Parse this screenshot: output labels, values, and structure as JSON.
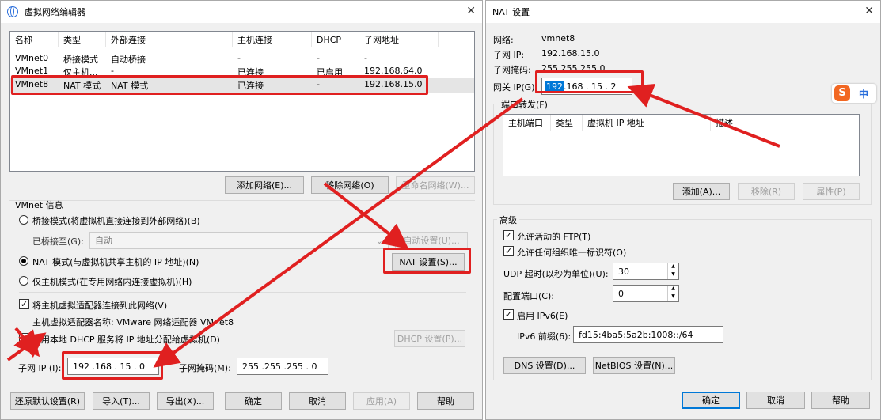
{
  "vne": {
    "title": "虚拟网络编辑器",
    "columns": [
      "名称",
      "类型",
      "外部连接",
      "主机连接",
      "DHCP",
      "子网地址"
    ],
    "rows": [
      [
        "VMnet0",
        "桥接模式",
        "自动桥接",
        "-",
        "-",
        "-"
      ],
      [
        "VMnet1",
        "仅主机...",
        "-",
        "已连接",
        "已启用",
        "192.168.64.0"
      ],
      [
        "VMnet8",
        "NAT 模式",
        "NAT 模式",
        "已连接",
        "-",
        "192.168.15.0"
      ]
    ],
    "add_network": "添加网络(E)...",
    "remove_network": "移除网络(O)",
    "rename_network": "重命名网络(W)...",
    "vmnet_info": "VMnet 信息",
    "bridge_mode": "桥接模式(将虚拟机直接连接到外部网络)(B)",
    "bridged_to_label": "已桥接至(G):",
    "bridged_to_value": "自动",
    "auto_settings": "自动设置(U)...",
    "nat_mode": "NAT 模式(与虚拟机共享主机的 IP 地址)(N)",
    "nat_settings": "NAT 设置(S)...",
    "hostonly_mode": "仅主机模式(在专用网络内连接虚拟机)(H)",
    "connect_adapter": "将主机虚拟适配器连接到此网络(V)",
    "adapter_name": "主机虚拟适配器名称: VMware 网络适配器 VMnet8",
    "use_dhcp": "使用本地 DHCP 服务将 IP 地址分配给虚拟机(D)",
    "dhcp_settings": "DHCP 设置(P)...",
    "subnet_ip_label": "子网 IP (I):",
    "subnet_ip": "192 .168 . 15 . 0",
    "subnet_mask_label": "子网掩码(M):",
    "subnet_mask": "255 .255 .255 . 0",
    "restore_defaults": "还原默认设置(R)",
    "import": "导入(T)...",
    "export": "导出(X)...",
    "ok": "确定",
    "cancel": "取消",
    "apply": "应用(A)",
    "help": "帮助"
  },
  "nat": {
    "title": "NAT 设置",
    "network_label": "网络:",
    "network": "vmnet8",
    "subnet_ip_label": "子网 IP:",
    "subnet_ip": "192.168.15.0",
    "subnet_mask_label": "子网掩码:",
    "subnet_mask": "255.255.255.0",
    "gateway_label": "网关 IP(G):",
    "gateway_sel": "192",
    "gateway_rest": " .168 . 15 . 2",
    "port_forward": "端口转发(F)",
    "pf_columns": [
      "主机端口",
      "类型",
      "虚拟机 IP 地址",
      "描述"
    ],
    "add": "添加(A)...",
    "remove": "移除(R)",
    "properties": "属性(P)",
    "advanced": "高级",
    "allow_ftp": "允许活动的 FTP(T)",
    "allow_oui": "允许任何组织唯一标识符(O)",
    "udp_timeout_label": "UDP 超时(以秒为单位)(U):",
    "udp_timeout": "30",
    "config_port_label": "配置端口(C):",
    "config_port": "0",
    "enable_ipv6": "启用 IPv6(E)",
    "ipv6_prefix_label": "IPv6 前缀(6):",
    "ipv6_prefix": "fd15:4ba5:5a2b:1008::/64",
    "dns_settings": "DNS 设置(D)...",
    "netbios_settings": "NetBIOS 设置(N)...",
    "ok": "确定",
    "cancel": "取消",
    "help": "帮助"
  },
  "ime": {
    "logo": "S",
    "mode": "中"
  },
  "colors": {
    "annotation": "#e02020",
    "selection": "#0078d7",
    "ime_orange": "#f26722",
    "ime_blue": "#2a6edb"
  }
}
